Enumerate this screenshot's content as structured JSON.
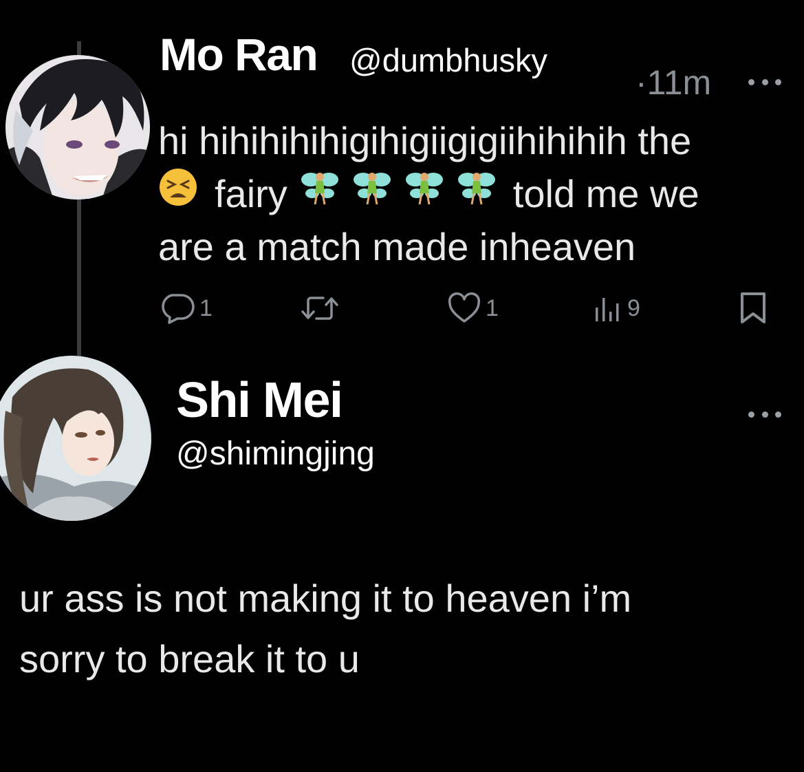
{
  "tweet": {
    "author": {
      "name": "Mo Ran",
      "handle": "@dumbhusky",
      "avatar": "avatar-mo-ran"
    },
    "timestamp": "·11m",
    "text": {
      "line1": "hi hihihihihigihigiigigiihihihih the",
      "line2_a": "fairy",
      "line2_b": "told me we",
      "line3": "are a match made inheaven"
    },
    "emojis": [
      "tired-face-emoji",
      "fairy-emoji",
      "fairy-emoji",
      "fairy-emoji",
      "fairy-emoji"
    ],
    "actions": {
      "replies": "1",
      "likes": "1",
      "views": "9"
    },
    "more_icon": "more-dots-icon"
  },
  "reply": {
    "author": {
      "name": "Shi Mei",
      "handle": "@shimingjing",
      "avatar": "avatar-shi-mei"
    },
    "text": {
      "line1": "ur ass is not making it to heaven i’m",
      "line2": "sorry to break it to u"
    },
    "more_icon": "more-dots-icon"
  },
  "colors": {
    "background": "#000000",
    "text": "#e7e9ea",
    "secondary": "#8b9096",
    "thread_line": "#3a3c40"
  }
}
